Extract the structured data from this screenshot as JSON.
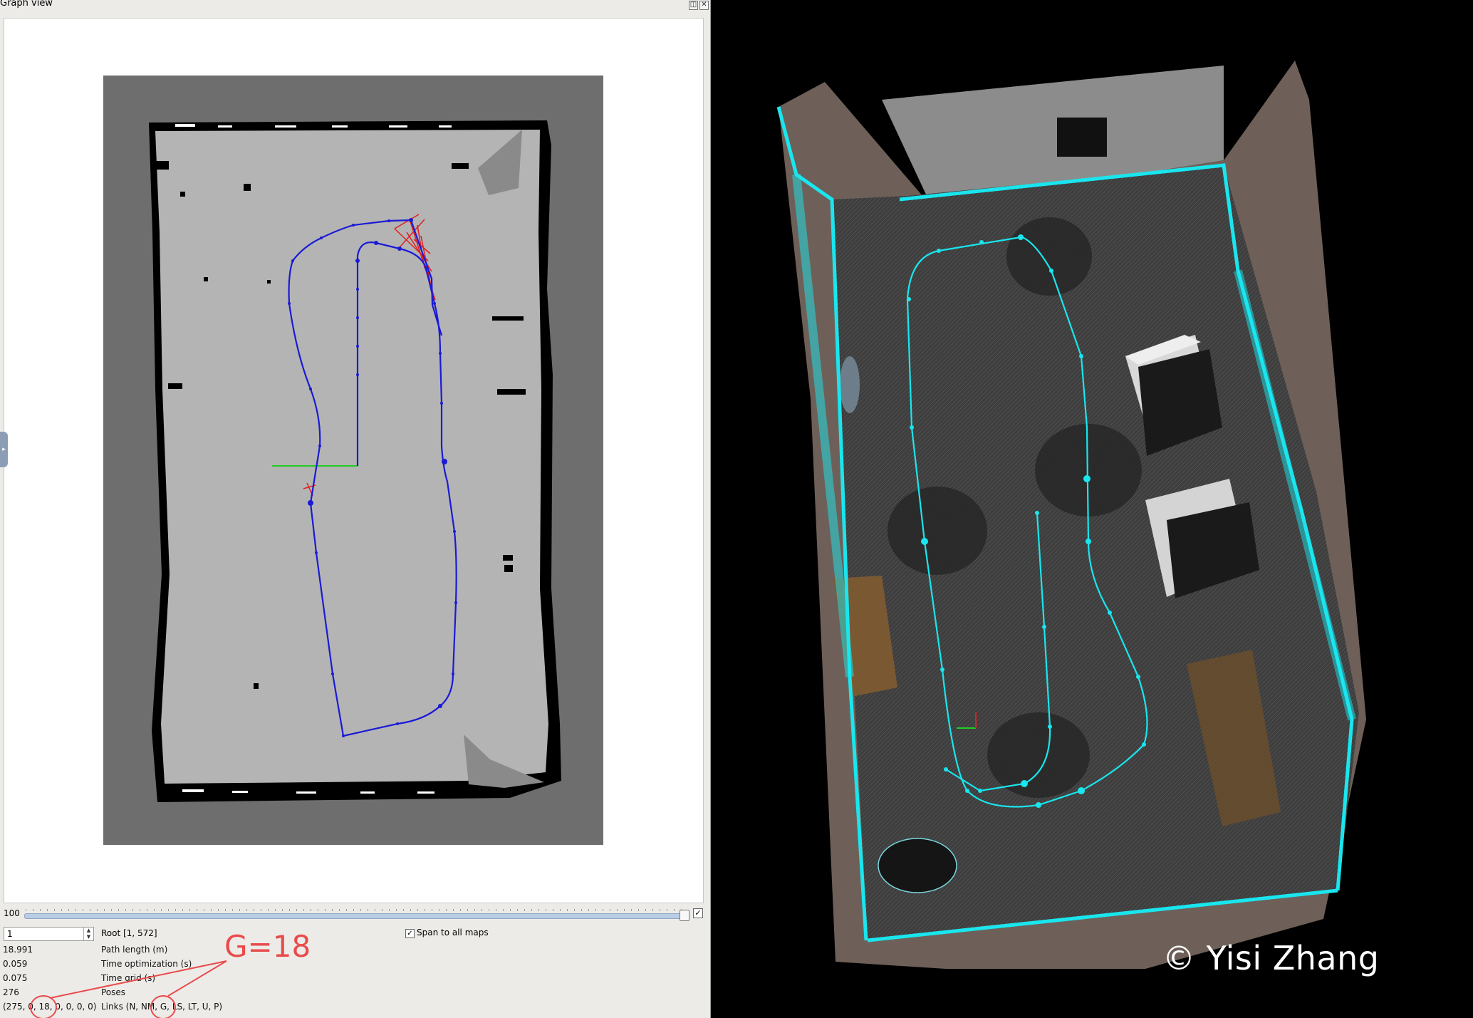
{
  "window": {
    "title": "Graph view",
    "float_button": "◫",
    "close_button": "✕"
  },
  "side_handle": "▸",
  "slider": {
    "value": "100",
    "checkbox": "✓"
  },
  "root": {
    "spin_value": "1",
    "label": "Root [1, 572]"
  },
  "span_maps": {
    "label": "Span to all maps",
    "checked": "✓"
  },
  "stats": [
    {
      "value": "18.991",
      "label": "Path length (m)"
    },
    {
      "value": "0.059",
      "label": "Time optimization (s)"
    },
    {
      "value": "0.075",
      "label": "Time grid (s)"
    },
    {
      "value": "276",
      "label": "Poses"
    },
    {
      "value": "(275, 0, 18, 0, 0, 0, 0)",
      "label": "Links (N, NM, G, LS, LT, U, P)"
    }
  ],
  "annotation": {
    "text": "G=18",
    "color": "#e94b4b"
  },
  "copyright": "© Yisi Zhang",
  "colors": {
    "path_blue": "#1a1ad6",
    "loop_red": "#e02020",
    "origin_green": "#22cc22",
    "cloud_cyan": "#19e6ee",
    "map_free": "#b4b4b4",
    "map_unknown": "#6e6e6e"
  }
}
